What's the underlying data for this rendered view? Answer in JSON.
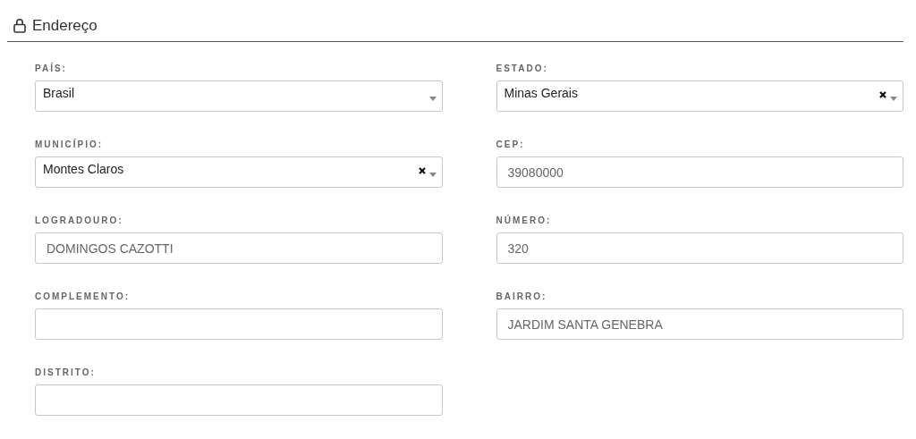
{
  "section": {
    "title": "Endereço"
  },
  "fields": [
    {
      "label": "PAÍS:",
      "kind": "select",
      "value": "Brasil",
      "clearable": false
    },
    {
      "label": "ESTADO:",
      "kind": "select",
      "value": "Minas Gerais",
      "clearable": true
    },
    {
      "label": "MUNICÍPIO:",
      "kind": "select",
      "value": "Montes Claros",
      "clearable": true
    },
    {
      "label": "CEP:",
      "kind": "input",
      "value": "39080000"
    },
    {
      "label": "LOGRADOURO:",
      "kind": "input",
      "value": "DOMINGOS CAZOTTI"
    },
    {
      "label": "NÚMERO:",
      "kind": "input",
      "value": "320"
    },
    {
      "label": "COMPLEMENTO:",
      "kind": "input"
    },
    {
      "label": "BAIRRO:",
      "kind": "input",
      "value": "JARDIM SANTA GENEBRA"
    },
    {
      "label": "DISTRITO:",
      "kind": "input"
    }
  ]
}
